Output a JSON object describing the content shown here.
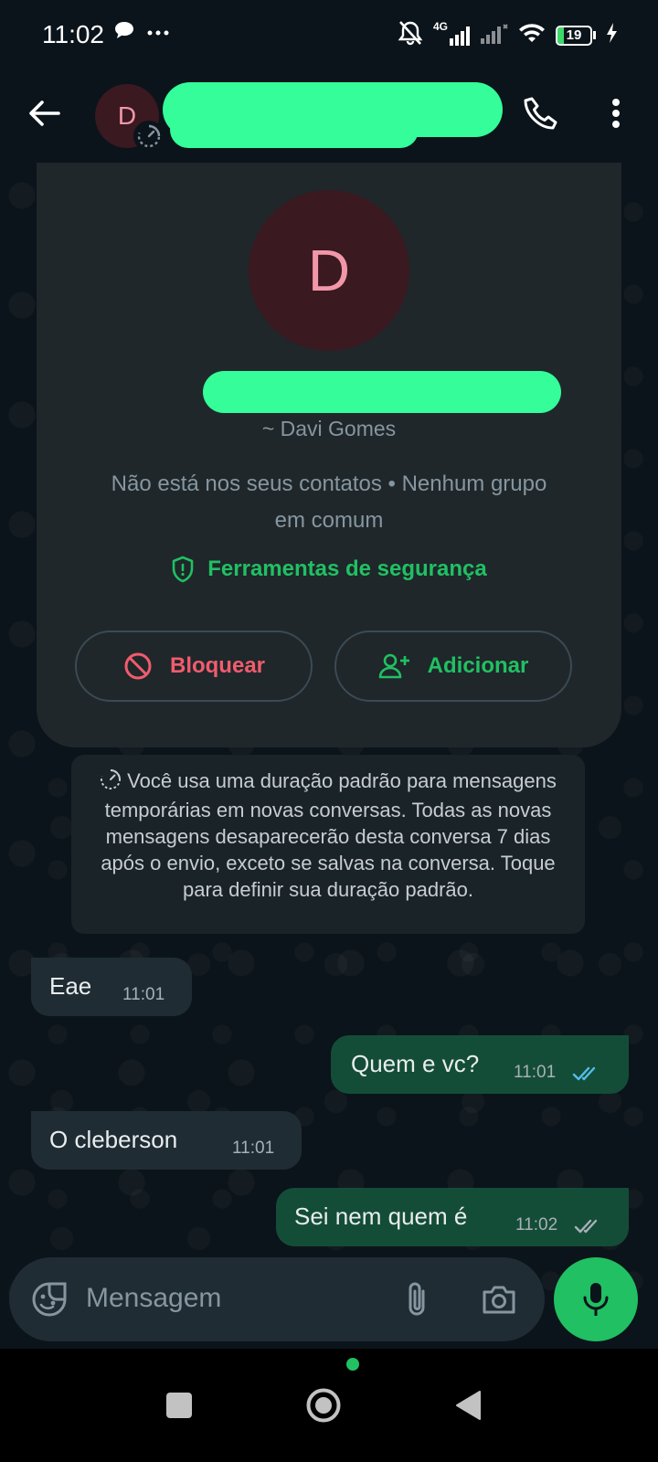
{
  "status_bar": {
    "time": "11:02",
    "network_type": "4G",
    "battery_level": "19",
    "battery_percent": 19
  },
  "header": {
    "avatar_initial": "D",
    "contact_name": "",
    "icons": [
      "arrow-back-icon",
      "disappearing-timer-icon",
      "phone-call-icon",
      "more-vert-icon"
    ]
  },
  "profile_card": {
    "avatar_initial": "D",
    "phone_number": "",
    "pushname": "~ Davi Gomes",
    "not_in_contacts": "Não está nos seus contatos • Nenhum grupo em comum",
    "safety_tools": "Ferramentas de segurança",
    "block_label": "Bloquear",
    "add_label": "Adicionar"
  },
  "system_message": "Você usa uma duração padrão para mensagens temporárias em novas conversas. Todas as novas mensagens desaparecerão desta conversa 7 dias após o envio, exceto se salvas na conversa. Toque para definir sua duração padrão.",
  "messages": [
    {
      "direction": "incoming",
      "text": "Eae",
      "time": "11:01"
    },
    {
      "direction": "outgoing",
      "text": "Quem e vc?",
      "time": "11:01",
      "status": "read"
    },
    {
      "direction": "incoming",
      "text": "O cleberson",
      "time": "11:01"
    },
    {
      "direction": "outgoing",
      "text": "Sei nem quem é",
      "time": "11:02",
      "status": "delivered"
    }
  ],
  "composer": {
    "placeholder": "Mensagem"
  },
  "colors": {
    "accent": "#21c063",
    "danger": "#f15c6d",
    "read_tick": "#53bdeb",
    "outgoing_bubble": "#144d37",
    "incoming_bubble": "#1f2c33",
    "redaction": "#34fd9a"
  }
}
